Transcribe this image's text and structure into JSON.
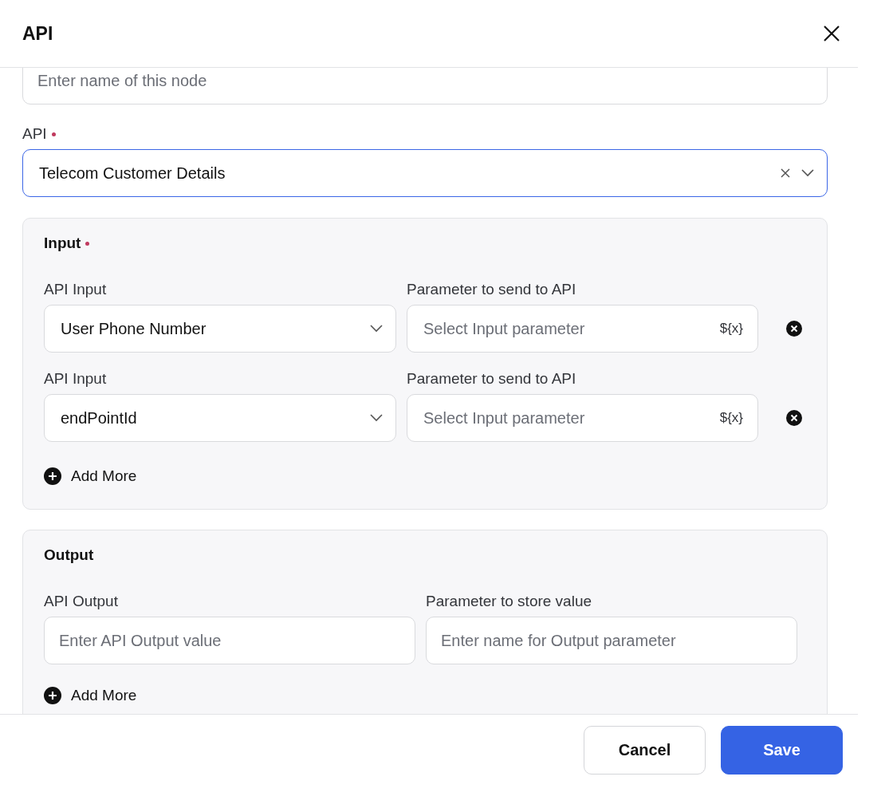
{
  "dialog": {
    "title": "API"
  },
  "name_field": {
    "placeholder": "Enter name of this node"
  },
  "api_field": {
    "label": "API",
    "required": true,
    "value": "Telecom Customer Details",
    "focused": true
  },
  "input_section": {
    "title": "Input",
    "required": true,
    "add_more": "Add More",
    "rows": [
      {
        "input_label": "API Input",
        "input_value": "User Phone Number",
        "param_label": "Parameter to send to API",
        "param_placeholder": "Select Input parameter",
        "variable_symbol": "${x}"
      },
      {
        "input_label": "API Input",
        "input_value": "endPointId",
        "param_label": "Parameter to send to API",
        "param_placeholder": "Select Input parameter",
        "variable_symbol": "${x}"
      }
    ]
  },
  "output_section": {
    "title": "Output",
    "required": false,
    "add_more": "Add More",
    "rows": [
      {
        "output_label": "API Output",
        "output_placeholder": "Enter API Output value",
        "store_label": "Parameter to store value",
        "store_placeholder": "Enter name for Output parameter"
      }
    ]
  },
  "buttons": [
    {
      "label": "Cancel",
      "kind": "secondary"
    },
    {
      "label": "Save",
      "kind": "primary"
    }
  ]
}
